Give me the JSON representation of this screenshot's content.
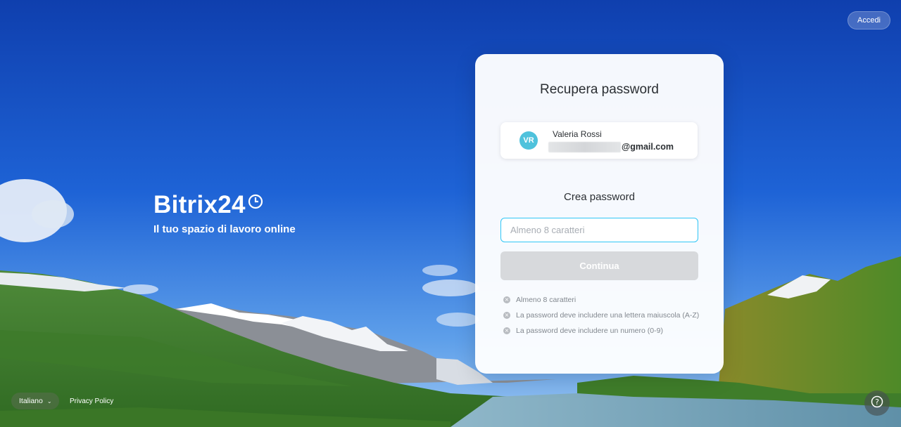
{
  "header": {
    "login_label": "Accedi"
  },
  "brand": {
    "logo_text": "Bitrix24",
    "tagline": "Il tuo spazio di lavoro online"
  },
  "card": {
    "title": "Recupera password",
    "user": {
      "initials": "VR",
      "name": "Valeria Rossi",
      "email_domain": "@gmail.com"
    },
    "section_title": "Crea password",
    "password_placeholder": "Almeno 8 caratteri",
    "continue_label": "Continua",
    "rules": [
      "Almeno 8 caratteri",
      "La password deve includere una lettera maiuscola (A-Z)",
      "La password deve includere un numero (0-9)"
    ]
  },
  "footer": {
    "language": "Italiano",
    "privacy_label": "Privacy Policy"
  },
  "colors": {
    "accent": "#2fc6f6",
    "avatar": "#4fc2dc",
    "button_disabled": "#d7d9dc"
  }
}
